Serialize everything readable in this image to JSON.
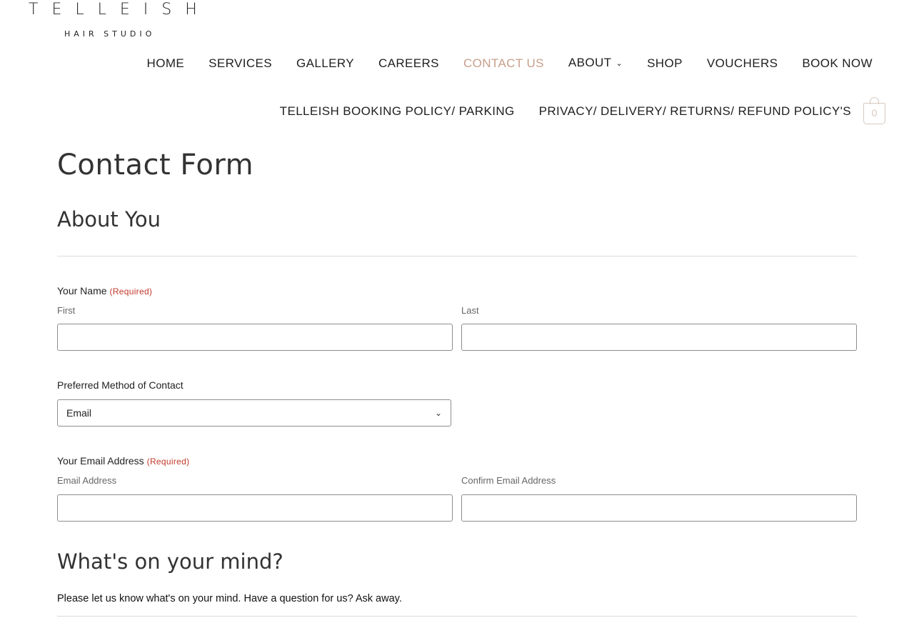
{
  "logo": {
    "name": "TELLEISH",
    "subtitle": "HAIR STUDIO"
  },
  "nav": {
    "row1": [
      {
        "label": "HOME",
        "active": false
      },
      {
        "label": "SERVICES",
        "active": false
      },
      {
        "label": "GALLERY",
        "active": false
      },
      {
        "label": "CAREERS",
        "active": false
      },
      {
        "label": "CONTACT US",
        "active": true
      },
      {
        "label": "ABOUT",
        "active": false,
        "dropdown": true
      },
      {
        "label": "SHOP",
        "active": false
      },
      {
        "label": "VOUCHERS",
        "active": false
      },
      {
        "label": "BOOK NOW",
        "active": false
      }
    ],
    "row2": [
      {
        "label": "TELLEISH BOOKING POLICY/ PARKING"
      },
      {
        "label": "PRIVACY/ DELIVERY/ RETURNS/ REFUND POLICY'S"
      }
    ],
    "cart_count": "0",
    "active_color": "#c89f8b"
  },
  "page": {
    "title": "Contact Form",
    "section_about": "About You",
    "name_field": {
      "label": "Your Name",
      "required": "(Required)",
      "first_label": "First",
      "last_label": "Last",
      "first_value": "",
      "last_value": ""
    },
    "contact_method": {
      "label": "Preferred Method of Contact",
      "selected": "Email"
    },
    "email_field": {
      "label": "Your Email Address",
      "required": "(Required)",
      "email_label": "Email Address",
      "confirm_label": "Confirm Email Address",
      "email_value": "",
      "confirm_value": ""
    },
    "section_mind": "What's on your mind?",
    "mind_description": "Please let us know what's on your mind. Have a question for us? Ask away."
  }
}
